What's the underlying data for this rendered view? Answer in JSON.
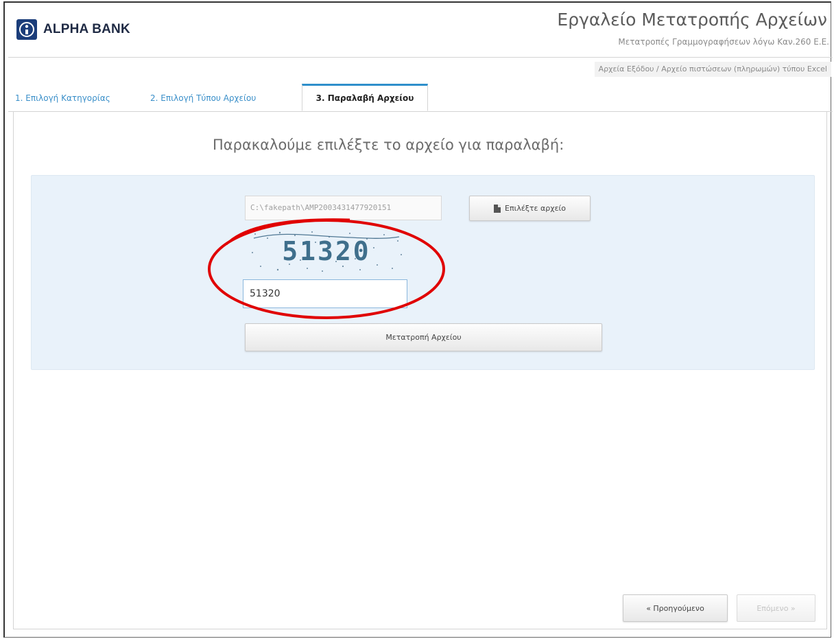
{
  "header": {
    "brand": "ALPHA BANK",
    "title": "Εργαλείο Μετατροπής Αρχείων",
    "subtitle": "Μετατροπές Γραμμογραφήσεων λόγω Καν.260 Ε.Ε.",
    "breadcrumb": "Αρχεία Εξόδου / Αρχείο πιστώσεων (πληρωμών) τύπου Excel"
  },
  "tabs": [
    {
      "label": "1. Επιλογή Κατηγορίας"
    },
    {
      "label": "2. Επιλογή Τύπου Αρχείου"
    },
    {
      "label": "3. Παραλαβή Αρχείου"
    }
  ],
  "main": {
    "prompt": "Παρακαλούμε επιλέξτε το αρχείο για παραλαβή:",
    "file_path": "C:\\fakepath\\AMP2003431477920151",
    "choose_file_label": "Επιλέξτε αρχείο",
    "captcha_text": "51320",
    "captcha_value": "51320",
    "convert_label": "Μετατροπή Αρχείου"
  },
  "footer": {
    "prev_label": "« Προηγούμενο",
    "next_label": "Επόμενο »"
  },
  "colors": {
    "tab_link": "#3a8fc9",
    "tab_active_border": "#2e8fcb",
    "panel_bg": "#e9f2fa",
    "annotation_ellipse": "#e00000"
  }
}
